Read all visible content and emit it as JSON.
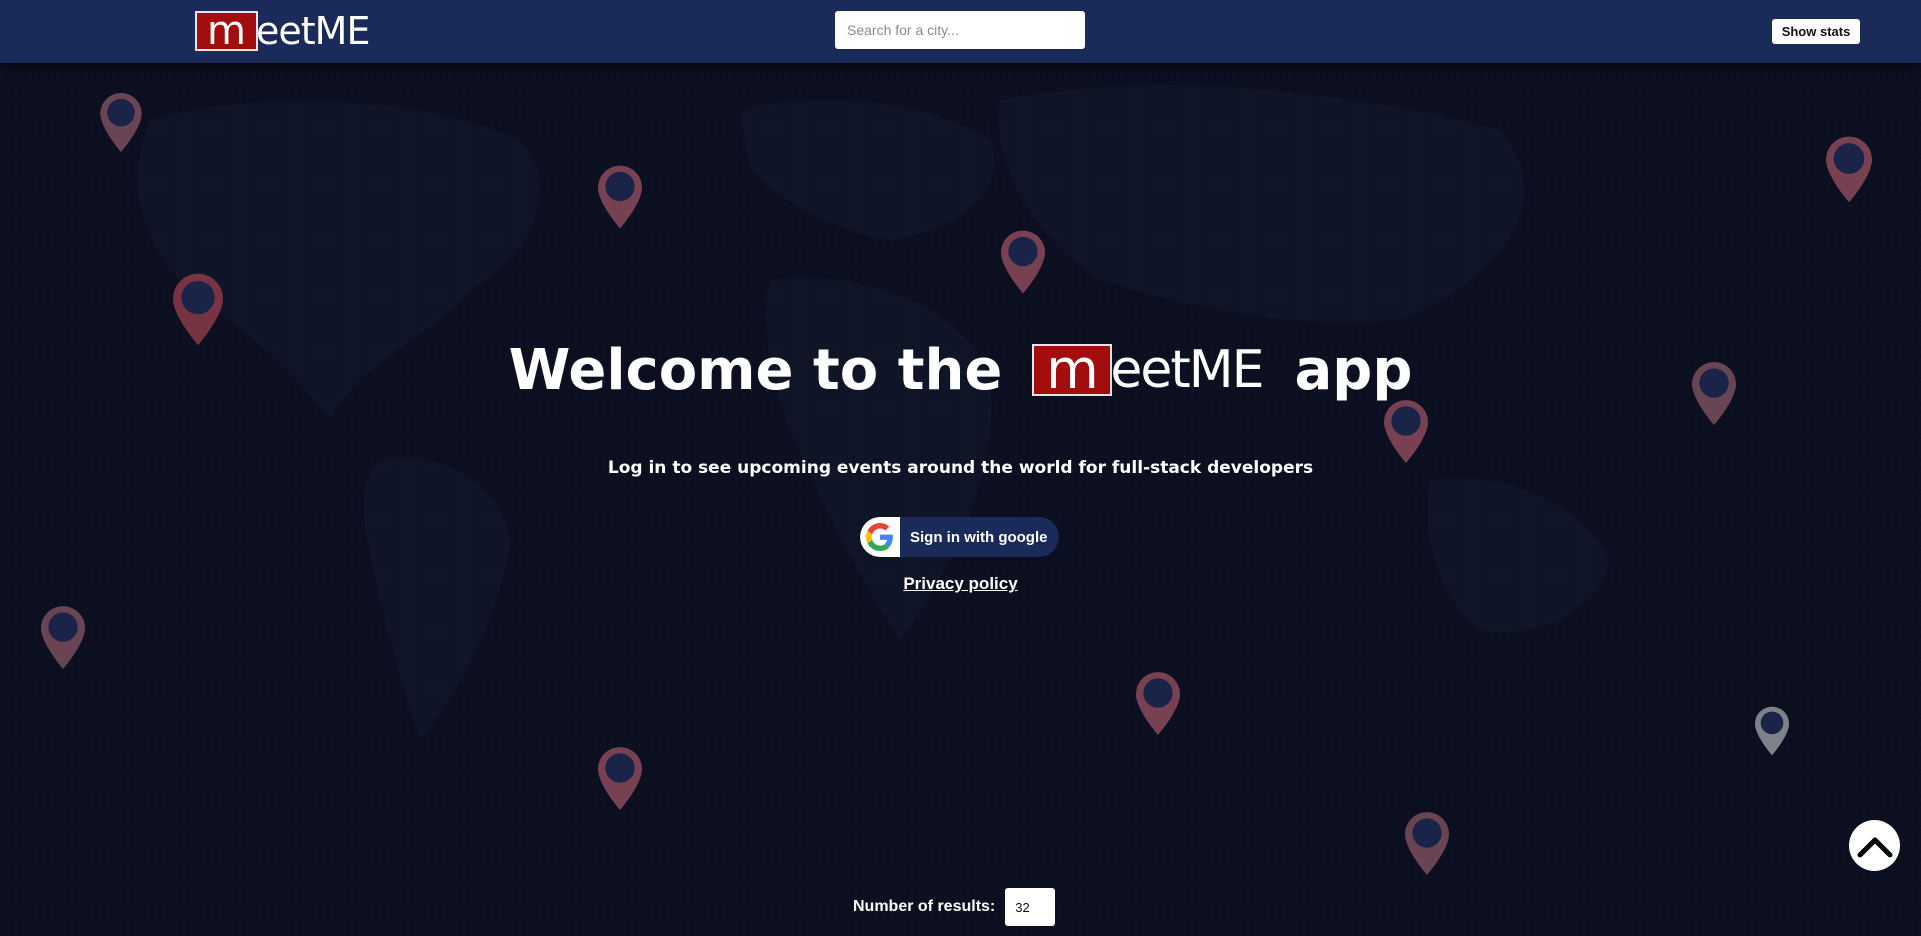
{
  "header": {
    "logo_initial": "m",
    "logo_rest": "eetME",
    "search_placeholder": "Search for a city...",
    "stats_button_label": "Show stats"
  },
  "hero": {
    "welcome_before": "Welcome to the",
    "logo_initial": "m",
    "logo_rest": "eetME",
    "welcome_after": "app",
    "subtitle": "Log in to see upcoming events around the world for full-stack developers",
    "google_button_label": "Sign in with google",
    "privacy_link": "Privacy policy"
  },
  "footer": {
    "results_label": "Number of results:",
    "results_value": "32"
  },
  "colors": {
    "background": "#0b0f20",
    "topbar": "#1a2b5a",
    "logo_red": "#a40d0d",
    "pin_red": "#8c4a5a",
    "pin_grey": "#8a8e96",
    "pin_hole": "#1a2348"
  },
  "icons": {
    "map_pins": "map-pin-icon",
    "google": "google-g-icon",
    "scroll_top": "chevron-up-icon"
  }
}
